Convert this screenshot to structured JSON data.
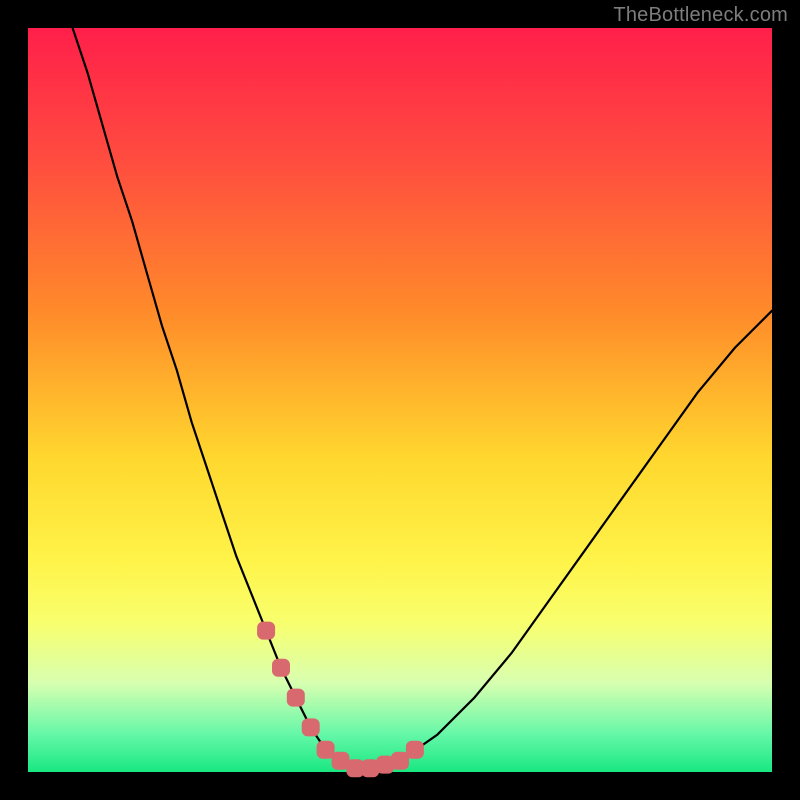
{
  "watermark": "TheBottleneck.com",
  "colors": {
    "page_bg": "#000000",
    "gradient_top": "#ff1f4a",
    "gradient_bottom": "#18e880",
    "curve": "#000000",
    "marker": "#d86a6f"
  },
  "chart_data": {
    "type": "line",
    "title": "",
    "xlabel": "",
    "ylabel": "",
    "xlim": [
      0,
      100
    ],
    "ylim": [
      0,
      100
    ],
    "series": [
      {
        "name": "bottleneck-curve",
        "x": [
          6,
          8,
          10,
          12,
          14,
          16,
          18,
          20,
          22,
          24,
          26,
          28,
          30,
          32,
          34,
          36,
          38,
          40,
          42,
          44,
          46,
          50,
          55,
          60,
          65,
          70,
          75,
          80,
          85,
          90,
          95,
          100
        ],
        "y": [
          100,
          94,
          87,
          80,
          74,
          67,
          60,
          54,
          47,
          41,
          35,
          29,
          24,
          19,
          14,
          10,
          6,
          3,
          1.5,
          0.5,
          0.5,
          1.5,
          5,
          10,
          16,
          23,
          30,
          37,
          44,
          51,
          57,
          62
        ]
      }
    ],
    "markers": {
      "name": "highlighted-range",
      "x": [
        32,
        34,
        36,
        38,
        40,
        42,
        44,
        46,
        48,
        50,
        52
      ],
      "y": [
        19,
        14,
        10,
        6,
        3,
        1.5,
        0.5,
        0.5,
        1,
        1.5,
        3
      ]
    }
  }
}
